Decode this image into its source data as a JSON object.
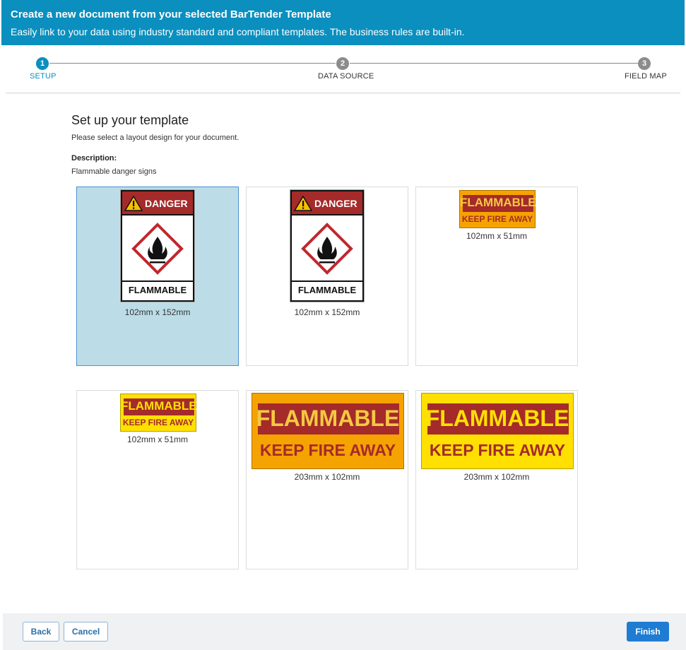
{
  "banner": {
    "title": "Create a new document from your selected BarTender Template",
    "subtitle": "Easily link to your data using industry standard and compliant templates. The business rules are built-in."
  },
  "stepper": {
    "steps": [
      {
        "number": "1",
        "label": "SETUP",
        "state": "active"
      },
      {
        "number": "2",
        "label": "DATA SOURCE",
        "state": "inactive"
      },
      {
        "number": "3",
        "label": "FIELD MAP",
        "state": "inactive"
      }
    ]
  },
  "setup": {
    "heading": "Set up your template",
    "instruction": "Please select a layout design for your document.",
    "description_label": "Description:",
    "description_value": "Flammable danger signs"
  },
  "templates": [
    {
      "size": "102mm x 152mm",
      "selected": true,
      "header_word": "DANGER",
      "footer_word": "FLAMMABLE"
    },
    {
      "size": "102mm x 152mm",
      "selected": false,
      "header_word": "DANGER",
      "footer_word": "FLAMMABLE"
    },
    {
      "size": "102mm x 51mm",
      "selected": false,
      "line1": "FLAMMABLE",
      "line2": "KEEP FIRE AWAY",
      "background": "#f5a300"
    },
    {
      "size": "102mm x 51mm",
      "selected": false,
      "line1": "FLAMMABLE",
      "line2": "KEEP FIRE AWAY",
      "background": "#ffe000"
    },
    {
      "size": "203mm x 102mm",
      "selected": false,
      "line1": "FLAMMABLE",
      "line2": "KEEP FIRE AWAY",
      "background": "#f5a300"
    },
    {
      "size": "203mm x 102mm",
      "selected": false,
      "line1": "FLAMMABLE",
      "line2": "KEEP FIRE AWAY",
      "background": "#ffe000"
    }
  ],
  "footer": {
    "back_label": "Back",
    "cancel_label": "Cancel",
    "finish_label": "Finish"
  },
  "colors": {
    "brand": "#0a8fbf",
    "primary_button": "#1f7cd3",
    "danger_red": "#a52a2a",
    "sign_orange": "#f5a300",
    "sign_yellow": "#ffe000",
    "selected_card": "#bcdde8"
  },
  "icons": [
    "warning-triangle-icon",
    "flame-pictogram-icon"
  ]
}
